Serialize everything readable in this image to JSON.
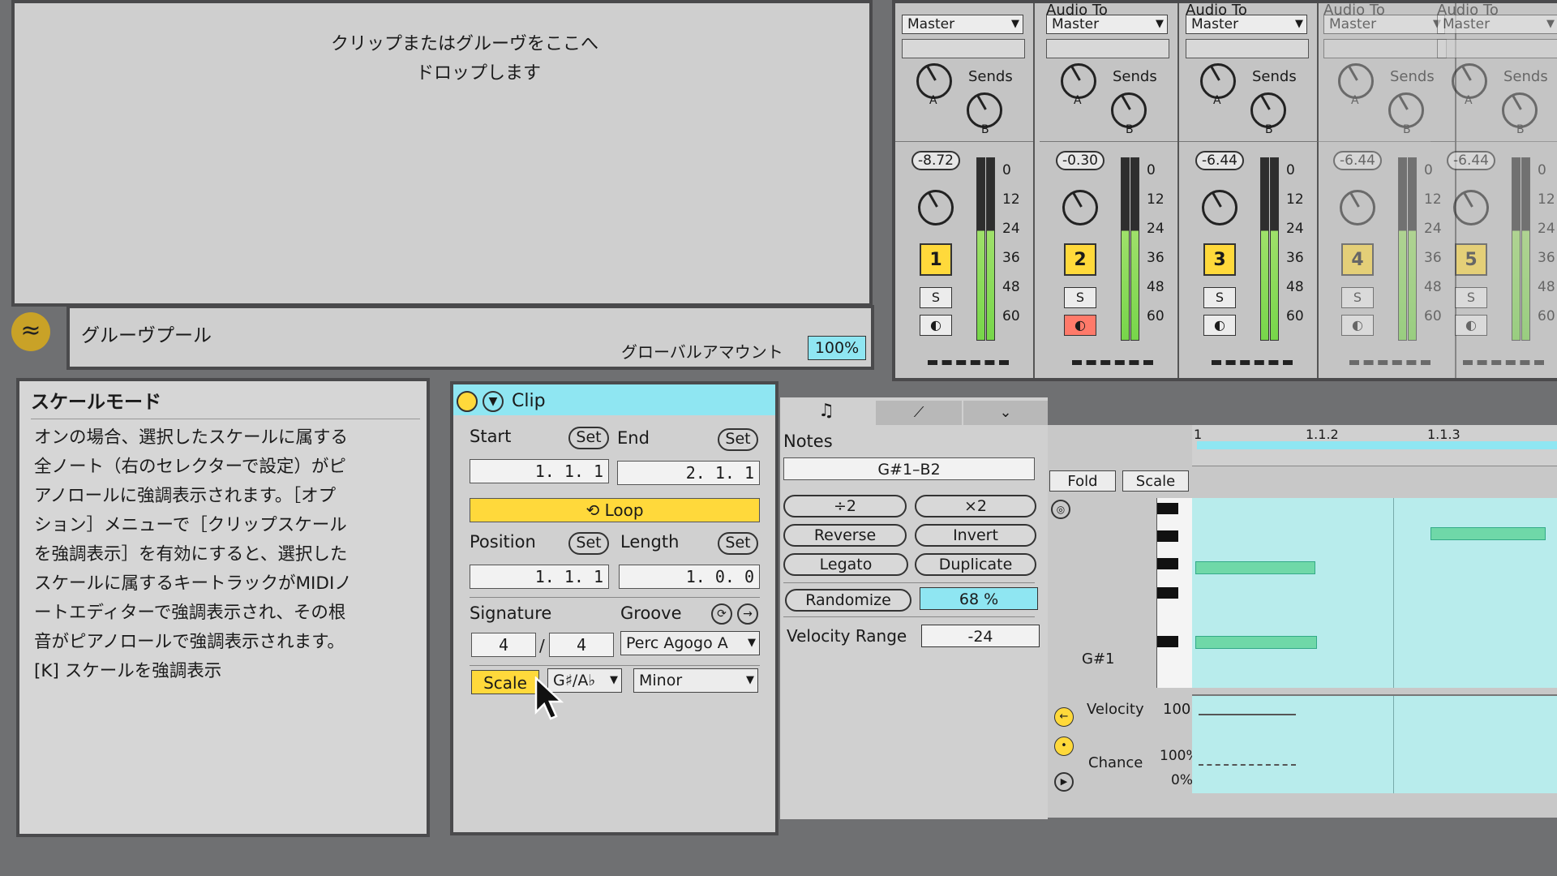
{
  "drop_area": {
    "line1": "クリップまたはグルーヴをここへ",
    "line2": "ドロップします"
  },
  "groove_pool": {
    "title": "グルーヴプール",
    "global_amount_label": "グローバルアマウント",
    "global_amount_value": "100%"
  },
  "info": {
    "title": "スケールモード",
    "lines": [
      "オンの場合、選択したスケールに属する",
      "全ノート（右のセレクターで設定）がピ",
      "アノロールに強調表示されます。［オプ",
      "ション］メニューで［クリップスケール",
      "を強調表示］を有効にすると、選択した",
      "スケールに属するキートラックがMIDIノ",
      "ートエディターで強調表示され、その根",
      "音がピアノロールで強調表示されます。",
      "[K] スケールを強調表示"
    ]
  },
  "mixer": {
    "tracks": [
      {
        "output_label": "",
        "output": "Master",
        "sends_label": "Sends",
        "send_a": "A",
        "send_b": "B",
        "volume": "-8.72",
        "number": "1",
        "solo": "S",
        "ticks": [
          "0",
          "12",
          "24",
          "36",
          "48",
          "60"
        ]
      },
      {
        "output_label": "Audio To",
        "output": "Master",
        "sends_label": "Sends",
        "send_a": "A",
        "send_b": "B",
        "volume": "-0.30",
        "number": "2",
        "solo": "S",
        "ticks": [
          "0",
          "12",
          "24",
          "36",
          "48",
          "60"
        ]
      },
      {
        "output_label": "Audio To",
        "output": "Master",
        "sends_label": "Sends",
        "send_a": "A",
        "send_b": "B",
        "volume": "-6.44",
        "number": "3",
        "solo": "S",
        "ticks": [
          "0",
          "12",
          "24",
          "36",
          "48",
          "60"
        ]
      },
      {
        "output_label": "Audio To",
        "output": "Master",
        "sends_label": "Sends",
        "send_a": "A",
        "send_b": "B",
        "volume": "-6.44",
        "number": "4",
        "solo": "S",
        "ticks": [
          "0",
          "12",
          "24",
          "36",
          "48",
          "60"
        ]
      },
      {
        "output_label": "Audio To",
        "output": "Master",
        "sends_label": "Sends",
        "send_a": "A",
        "send_b": "B",
        "volume": "-6.44",
        "number": "5",
        "solo": "S",
        "ticks": [
          "0",
          "12",
          "24",
          "36",
          "48",
          "60"
        ]
      }
    ]
  },
  "clip": {
    "title": "Clip",
    "start_label": "Start",
    "end_label": "End",
    "set": "Set",
    "start_value": "1.   1.   1",
    "end_value": "2.   1.   1",
    "loop": "Loop",
    "position_label": "Position",
    "length_label": "Length",
    "position_value": "1.   1.   1",
    "length_value": "1.   0.   0",
    "signature_label": "Signature",
    "groove_label": "Groove",
    "sig_num": "4",
    "sig_slash": "/",
    "sig_den": "4",
    "groove_value": "Perc Agogo A",
    "scale_button": "Scale",
    "scale_root": "G♯/A♭",
    "scale_mode": "Minor"
  },
  "notes": {
    "title": "Notes",
    "range": "G#1–B2",
    "div2": "÷2",
    "mul2": "×2",
    "reverse": "Reverse",
    "invert": "Invert",
    "legato": "Legato",
    "duplicate": "Duplicate",
    "randomize": "Randomize",
    "randomize_amount": "68 %",
    "velocity_range_label": "Velocity Range",
    "velocity_range_value": "-24"
  },
  "piano_roll": {
    "fold": "Fold",
    "scale": "Scale",
    "ruler": [
      "1",
      "1.1.2",
      "1.1.3"
    ],
    "key_label": "G#1",
    "velocity_label": "Velocity",
    "velocity_value": "100",
    "chance_label": "Chance",
    "chance_max": "100%",
    "chance_min": "0%"
  },
  "colors": {
    "accent_yellow": "#ffd93b",
    "clip_cyan": "#8fe6f2",
    "note_green": "#6fd8a8",
    "roll_bg": "#b8ecec"
  }
}
